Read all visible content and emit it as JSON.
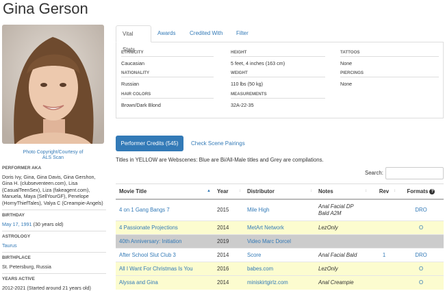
{
  "performer": {
    "name": "Gina Gerson",
    "photo_credit_line1": "Photo Copyright/Courtesy of",
    "photo_credit_line2": "ALS Scan"
  },
  "profile": {
    "aka_label": "PERFORMER AKA",
    "aka_value": "Doris Ivy, Gina, Gina Davis, Gina Gershon, Gina H. (clubseventeen.com), Lisa (CasualTeenSex), Liza (fakeagent.com), Manuela, Maya (SellYourGF), Penelope (HornyThiefTales), Valya C (Creampie-Angels)",
    "birthday_label": "BIRTHDAY",
    "birthday_date": "May 17, 1991",
    "birthday_age": " (30 years old)",
    "astrology_label": "ASTROLOGY",
    "astrology_value": "Taurus",
    "birthplace_label": "BIRTHPLACE",
    "birthplace_value": "St. Petersburg, Russia",
    "years_label": "YEARS ACTIVE",
    "years_value": "2012-2021 (Started around 21 years old)"
  },
  "tabs": [
    "Vital Stats",
    "Awards",
    "Credited With",
    "Filter"
  ],
  "stats": {
    "ethnicity_label": "ETHNICITY",
    "ethnicity": "Caucasian",
    "height_label": "HEIGHT",
    "height": "5 feet, 4 inches (163 cm)",
    "tattoos_label": "TATTOOS",
    "tattoos": "None",
    "nationality_label": "NATIONALITY",
    "nationality": "Russian",
    "weight_label": "WEIGHT",
    "weight": "110 lbs (50 kg)",
    "piercings_label": "PIERCINGS",
    "piercings": "None",
    "hair_label": "HAIR COLORS",
    "hair": "Brown/Dark Blond",
    "measurements_label": "MEASUREMENTS",
    "measurements": "32A-22-35"
  },
  "credits": {
    "button_label": "Performer Credits (545)",
    "pairings_label": "Check Scene Pairings",
    "legend": "Titles in YELLOW are Webscenes: Blue are Bi/All-Male titles and Grey are compilations.",
    "search_label": "Search:",
    "search_value": "",
    "columns": [
      "Movie Title",
      "Year",
      "Distributor",
      "Notes",
      "Rev",
      "Formats"
    ],
    "row_colors": {
      "white": "#ffffff",
      "yellow": "#fcfccf",
      "grey": "#cccccc"
    },
    "rows": [
      {
        "title": "4 on 1 Gang Bangs 7",
        "year": "2015",
        "distributor": "Mile High",
        "notes": "Anal Facial DP",
        "notes2": "Bald A2M",
        "rev": "",
        "formats": "DRO"
      },
      {
        "title": "4 Passionate Projections",
        "year": "2014",
        "distributor": "MetArt Network",
        "notes": "LezOnly",
        "notes2": "",
        "rev": "",
        "formats": "O"
      },
      {
        "title": "40th Anniversary: Initiation",
        "year": "2019",
        "distributor": "Video Marc Dorcel",
        "notes": "",
        "notes2": "",
        "rev": "",
        "formats": ""
      },
      {
        "title": "After School Slut Club 3",
        "year": "2014",
        "distributor": "Score",
        "notes": "Anal Facial Bald",
        "notes2": "",
        "rev": "1",
        "formats": "DRO"
      },
      {
        "title": "All I Want For Christmas Is You",
        "year": "2016",
        "distributor": "babes.com",
        "notes": "LezOnly",
        "notes2": "",
        "rev": "",
        "formats": "O"
      },
      {
        "title": "Alyssa and Gina",
        "year": "2014",
        "distributor": "miniskirtgirlz.com",
        "notes": "Anal Creampie",
        "notes2": "",
        "rev": "",
        "formats": "O"
      }
    ]
  }
}
